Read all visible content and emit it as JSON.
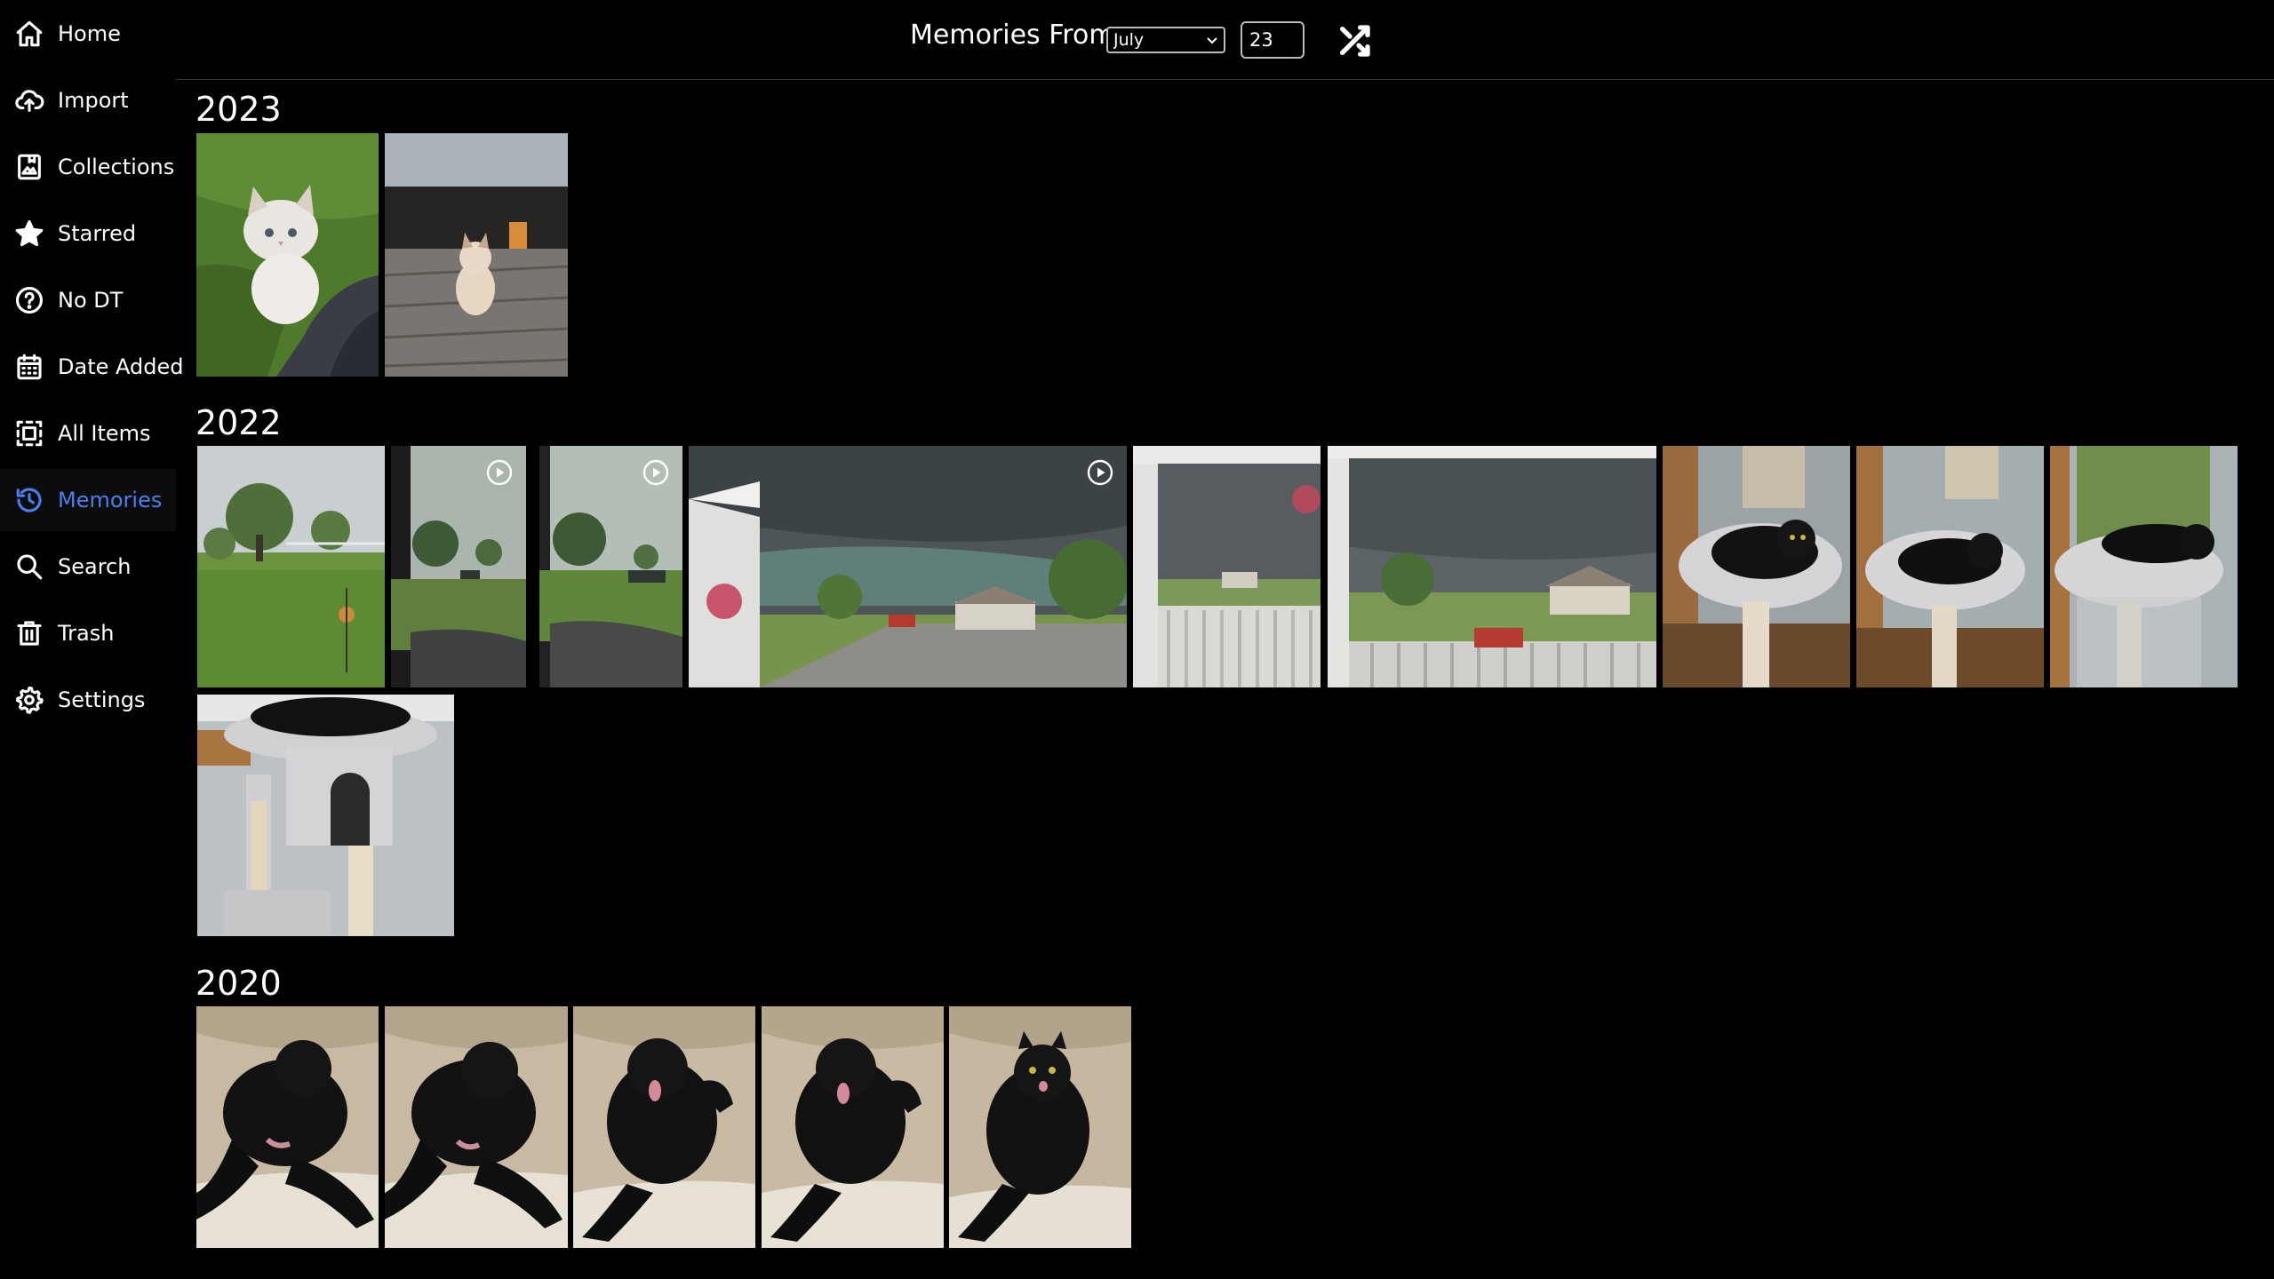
{
  "sidebar": {
    "items": [
      {
        "label": "Home",
        "icon": "home-icon"
      },
      {
        "label": "Import",
        "icon": "cloud-upload-icon"
      },
      {
        "label": "Collections",
        "icon": "album-icon"
      },
      {
        "label": "Starred",
        "icon": "star-icon"
      },
      {
        "label": "No DT",
        "icon": "question-circle-icon"
      },
      {
        "label": "Date Added",
        "icon": "calendar-icon"
      },
      {
        "label": "All Items",
        "icon": "grid-icon"
      },
      {
        "label": "Memories",
        "icon": "history-icon",
        "active": true
      },
      {
        "label": "Search",
        "icon": "search-icon"
      },
      {
        "label": "Trash",
        "icon": "trash-icon"
      },
      {
        "label": "Settings",
        "icon": "gear-icon"
      }
    ],
    "active_color": "#4a7ff0"
  },
  "header": {
    "title": "Memories From",
    "month": "July",
    "day": "23",
    "shuffle_icon": "shuffle-icon"
  },
  "groups": [
    {
      "year": "2023",
      "items": [
        {
          "subject": "kitten on grass",
          "video": false
        },
        {
          "subject": "kitten on truck bed",
          "video": false
        }
      ]
    },
    {
      "year": "2022",
      "items": [
        {
          "subject": "yard through window",
          "video": false
        },
        {
          "subject": "yard through window",
          "video": true
        },
        {
          "subject": "yard and truck",
          "video": true
        },
        {
          "subject": "storm clouds over street",
          "video": true
        },
        {
          "subject": "porch view of street",
          "video": false
        },
        {
          "subject": "storm over neighborhood",
          "video": false
        },
        {
          "subject": "black cat on cat tree",
          "video": false
        },
        {
          "subject": "black cat on cat tree",
          "video": false
        },
        {
          "subject": "black cat on cat tree",
          "video": false
        },
        {
          "subject": "black cat in cat tree",
          "video": false
        }
      ]
    },
    {
      "year": "2020",
      "items": [
        {
          "subject": "black cat grooming on couch",
          "video": false
        },
        {
          "subject": "black cat grooming on couch",
          "video": false
        },
        {
          "subject": "black cat grooming on couch",
          "video": false
        },
        {
          "subject": "black cat grooming on couch",
          "video": false
        },
        {
          "subject": "black cat on couch",
          "video": false
        }
      ]
    }
  ]
}
